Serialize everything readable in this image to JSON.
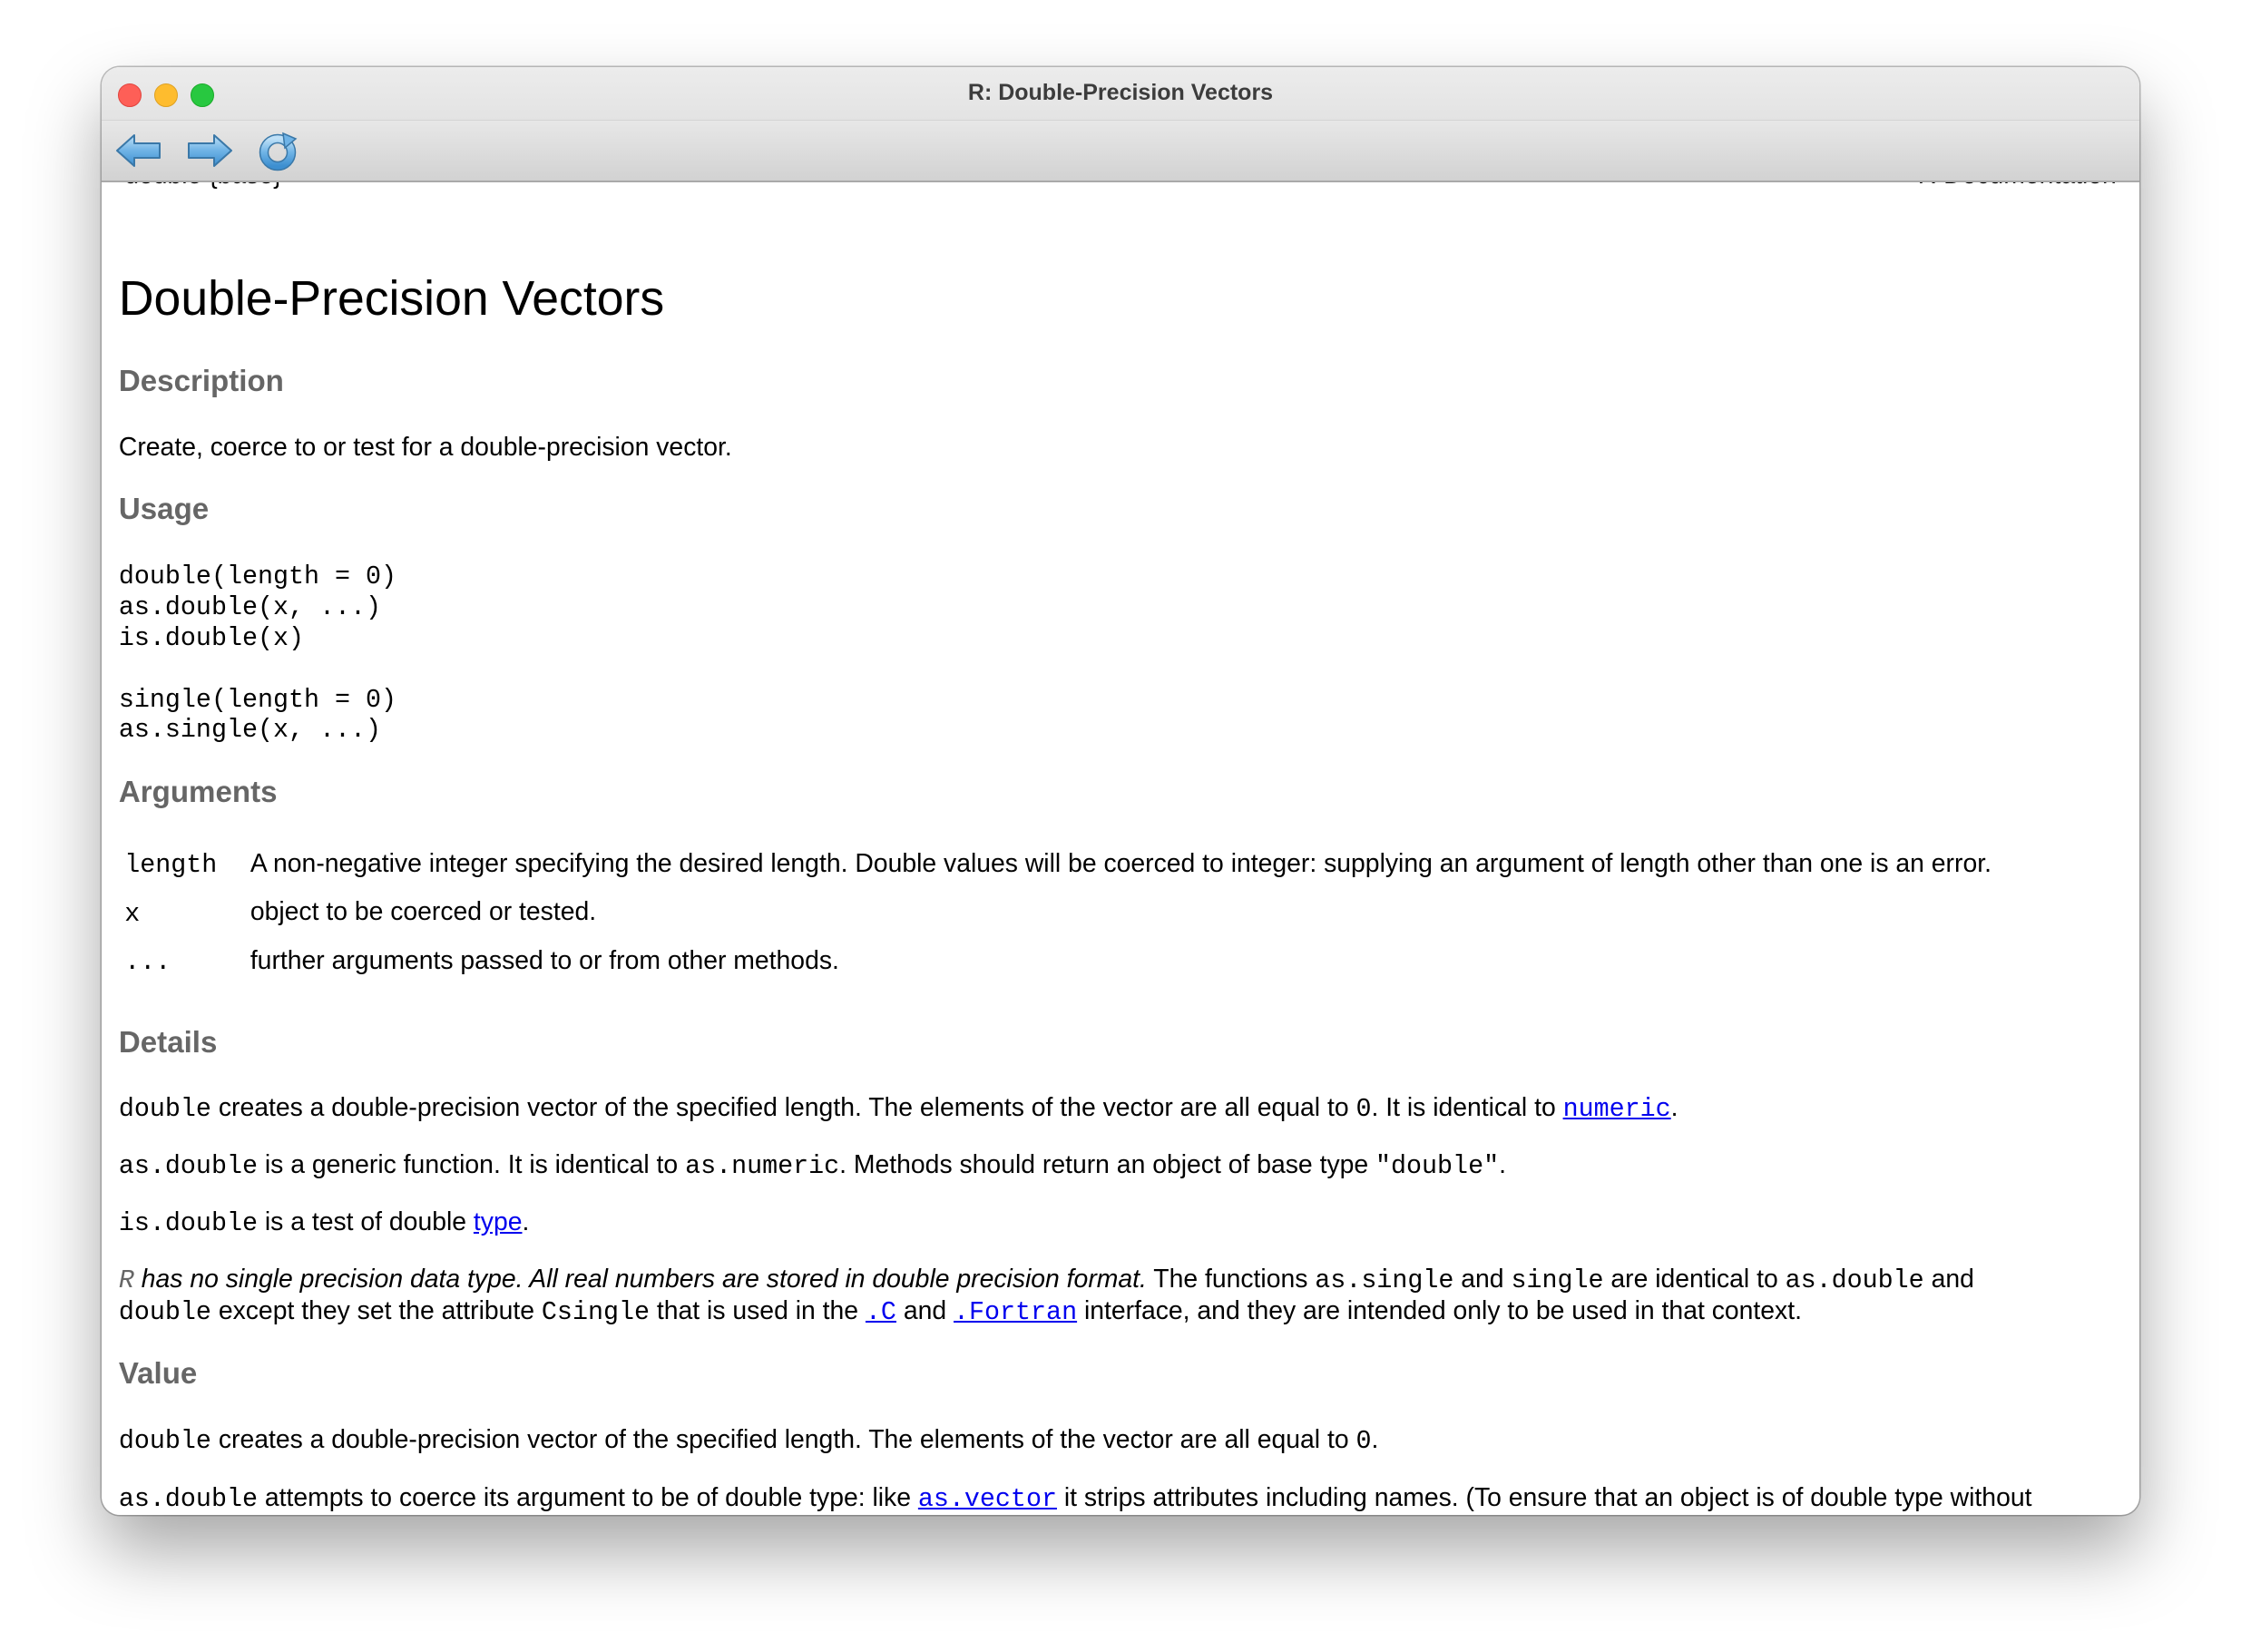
{
  "window": {
    "title": "R: Double-Precision Vectors"
  },
  "toolbar": {
    "back_icon": "back-arrow-icon",
    "forward_icon": "forward-arrow-icon",
    "reload_icon": "reload-icon"
  },
  "header": {
    "left": "double {base}",
    "right": "R Documentation"
  },
  "page_title": "Double-Precision Vectors",
  "sections": {
    "description": {
      "heading": "Description",
      "text": "Create, coerce to or test for a double-precision vector."
    },
    "usage": {
      "heading": "Usage",
      "lines": [
        "double(length = 0)",
        "as.double(x, ...)",
        "is.double(x)",
        "single(length = 0)",
        "as.single(x, ...)"
      ]
    },
    "arguments": {
      "heading": "Arguments",
      "items": [
        {
          "name": "length",
          "desc": "A non-negative integer specifying the desired length. Double values will be coerced to integer: supplying an argument of length other than one is an error."
        },
        {
          "name": "x",
          "desc": "object to be coerced or tested."
        },
        {
          "name": "...",
          "desc": "further arguments passed to or from other methods."
        }
      ]
    },
    "details": {
      "heading": "Details",
      "p1": {
        "code1": "double",
        "t1": " creates a double-precision vector of the specified length. The elements of the vector are all equal to ",
        "code2": "0",
        "t2": ". It is identical to ",
        "link": "numeric",
        "t3": "."
      },
      "p2": {
        "code1": "as.double",
        "t1": " is a generic function. It is identical to ",
        "code2": "as.numeric",
        "t2": ". Methods should return an object of base type ",
        "code3": "\"double\"",
        "t3": "."
      },
      "p3": {
        "code1": "is.double",
        "t1": " is a test of double ",
        "link": "type",
        "t2": "."
      },
      "p4": {
        "r": "R",
        "italic": " has no single precision data type. All real numbers are stored in double precision format.",
        "t1": " The functions ",
        "code1": "as.single",
        "t2": " and ",
        "code2": "single",
        "t3": " are identical to ",
        "code3": "as.double",
        "t4": " and",
        "code4": "double",
        "t5": " except they set the attribute ",
        "code5": "Csingle",
        "t6": " that is used in the ",
        "link1": ".C",
        "t7": " and ",
        "link2": ".Fortran",
        "t8": " interface, and they are intended only to be used in that context."
      }
    },
    "value": {
      "heading": "Value",
      "p1": {
        "code1": "double",
        "t1": " creates a double-precision vector of the specified length. The elements of the vector are all equal to ",
        "code2": "0",
        "t2": "."
      },
      "p2": {
        "code1": "as.double",
        "t1": " attempts to coerce its argument to be of double type: like ",
        "link": "as.vector",
        "t2": " it strips attributes including names. (To ensure that an object is of double type without"
      }
    }
  }
}
